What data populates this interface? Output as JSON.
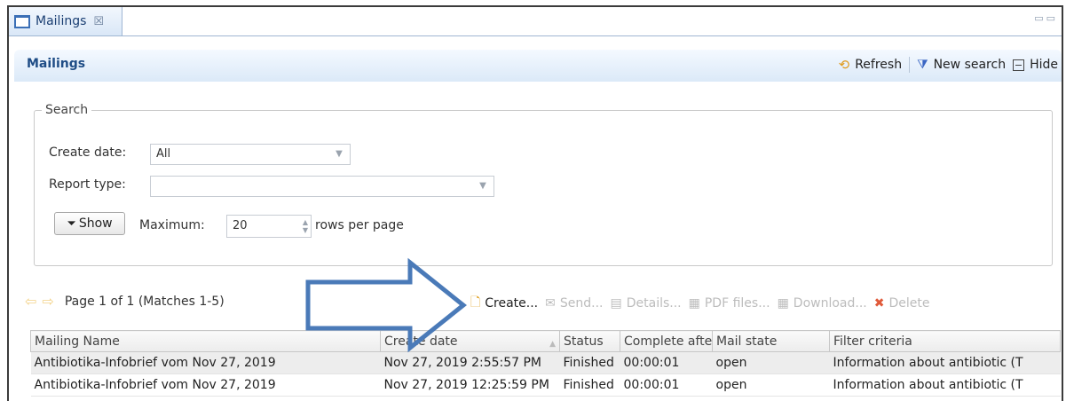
{
  "tab": {
    "label": "Mailings",
    "close": "☒"
  },
  "view_controls": "▭▭",
  "panel": {
    "title": "Mailings",
    "actions": {
      "refresh": "Refresh",
      "new_search": "New search",
      "hide": "Hide"
    }
  },
  "search": {
    "legend": "Search",
    "create_date_label": "Create date:",
    "create_date_value": "All",
    "report_type_label": "Report type:",
    "report_type_value": "",
    "show_button": "Show",
    "maximum_label": "Maximum:",
    "maximum_value": "20",
    "rows_per_page": "rows per page"
  },
  "pager": {
    "text": "Page 1 of 1 (Matches 1-5)"
  },
  "toolbar": {
    "create": "Create...",
    "send": "Send...",
    "details": "Details...",
    "pdf_files": "PDF files...",
    "download": "Download...",
    "delete": "Delete"
  },
  "grid": {
    "columns": [
      "Mailing Name",
      "Create date",
      "Status",
      "Complete afte",
      "Mail state",
      "Filter criteria"
    ],
    "rows": [
      [
        "Antibiotika-Infobrief vom Nov 27, 2019",
        "Nov 27, 2019 2:55:57 PM",
        "Finished",
        "00:00:01",
        "open",
        "Information about antibiotic (T"
      ],
      [
        "Antibiotika-Infobrief vom Nov 27, 2019",
        "Nov 27, 2019 12:25:59 PM",
        "Finished",
        "00:00:01",
        "open",
        "Information about antibiotic (T"
      ]
    ]
  },
  "colors": {
    "accent": "#1f4d86",
    "arrow": "#4a7ab8",
    "panel_bg": "#dbe9f8"
  }
}
